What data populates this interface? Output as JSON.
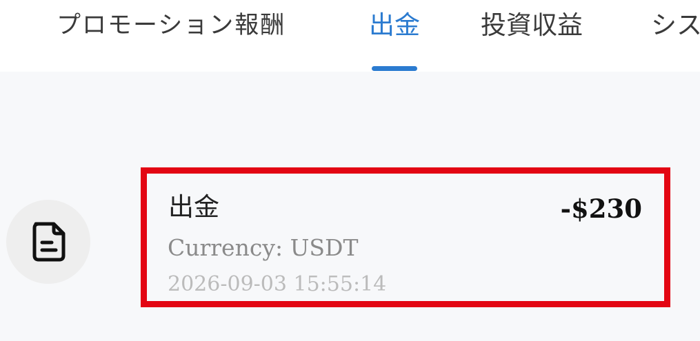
{
  "tabs": [
    {
      "label": "プロモーション報酬",
      "active": false
    },
    {
      "label": "出金",
      "active": true
    },
    {
      "label": "投資収益",
      "active": false
    },
    {
      "label": "シス",
      "active": false
    }
  ],
  "colors": {
    "accent": "#2b7bd0",
    "highlight_border": "#e30613"
  },
  "record": {
    "icon": "document-icon",
    "title": "出金",
    "amount": "-$230",
    "currency": "Currency: USDT",
    "timestamp": "2026-09-03 15:55:14"
  }
}
